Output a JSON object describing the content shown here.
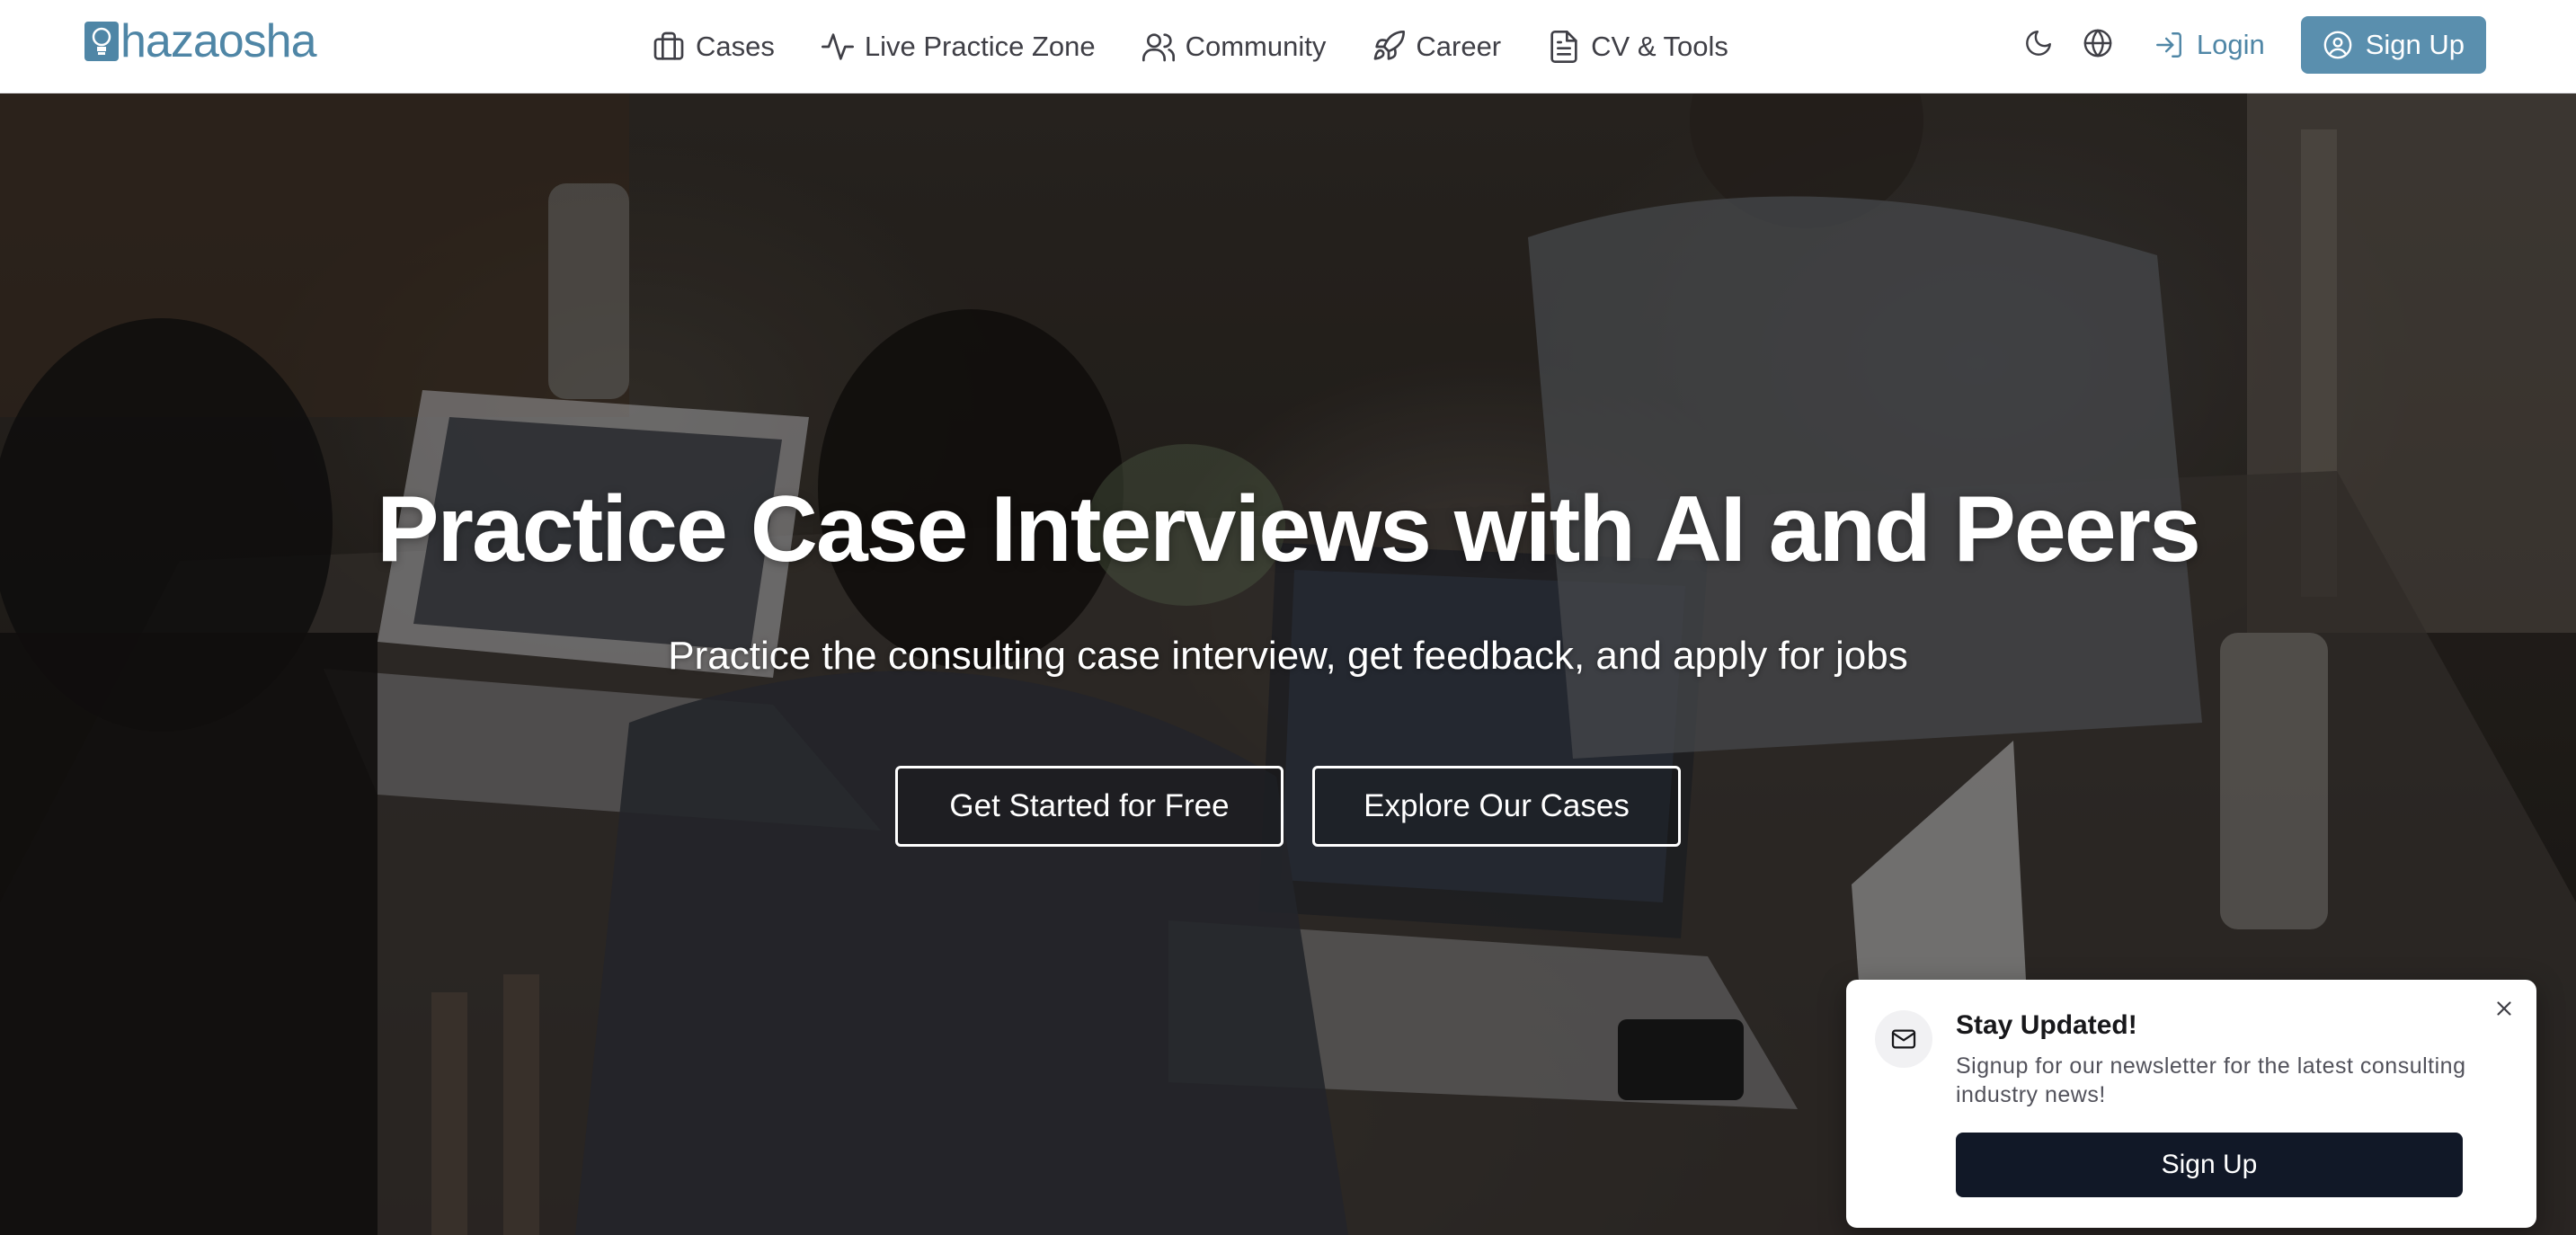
{
  "header": {
    "logo_text": "hazaosha",
    "nav": [
      {
        "label": "Cases",
        "icon": "briefcase-icon"
      },
      {
        "label": "Live Practice Zone",
        "icon": "activity-icon"
      },
      {
        "label": "Community",
        "icon": "users-icon"
      },
      {
        "label": "Career",
        "icon": "rocket-icon"
      },
      {
        "label": "CV & Tools",
        "icon": "file-text-icon"
      }
    ],
    "theme_toggle_icon": "moon-icon",
    "language_icon": "globe-icon",
    "login_label": "Login",
    "signup_label": "Sign Up",
    "brand_color": "#4f86a6"
  },
  "hero": {
    "title": "Practice Case Interviews with AI and Peers",
    "subtitle": "Practice the consulting case interview, get feedback, and apply for jobs",
    "primary_cta": "Get Started for Free",
    "secondary_cta": "Explore Our Cases"
  },
  "newsletter_popup": {
    "icon": "mail-icon",
    "title": "Stay Updated!",
    "text": "Signup for our newsletter for the latest consulting industry news!",
    "button_label": "Sign Up",
    "close_icon": "close-icon"
  }
}
